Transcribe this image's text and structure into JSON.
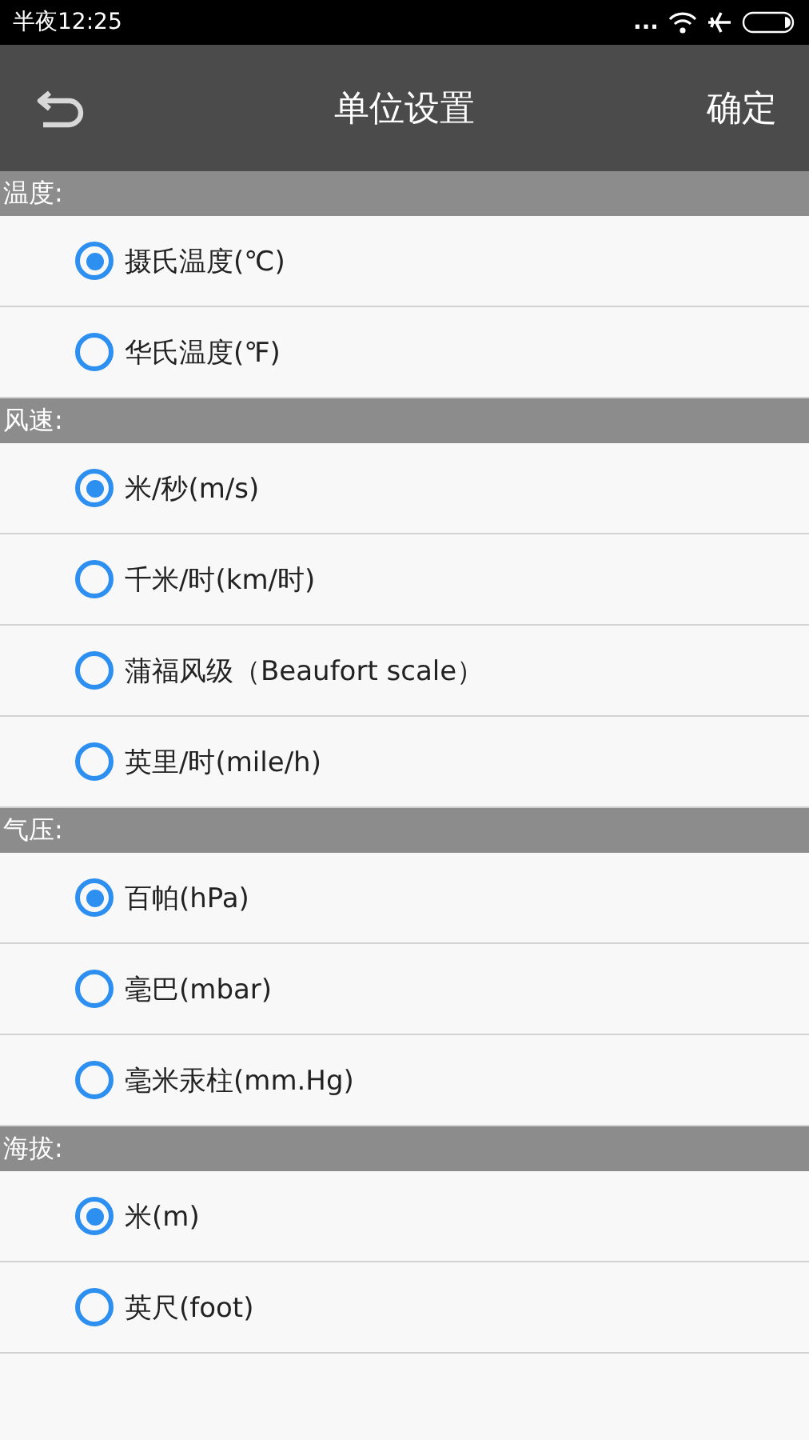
{
  "status_bar": {
    "time": "半夜12:25",
    "dots": "..."
  },
  "header": {
    "title": "单位设置",
    "confirm": "确定"
  },
  "sections": [
    {
      "title": "温度:",
      "options": [
        {
          "label": "摄氏温度(℃)",
          "selected": true
        },
        {
          "label": "华氏温度(℉)",
          "selected": false
        }
      ]
    },
    {
      "title": "风速:",
      "options": [
        {
          "label": "米/秒(m/s)",
          "selected": true
        },
        {
          "label": "千米/时(km/时)",
          "selected": false
        },
        {
          "label": "蒲福风级（Beaufort scale）",
          "selected": false
        },
        {
          "label": "英里/时(mile/h)",
          "selected": false
        }
      ]
    },
    {
      "title": "气压:",
      "options": [
        {
          "label": "百帕(hPa)",
          "selected": true
        },
        {
          "label": "毫巴(mbar)",
          "selected": false
        },
        {
          "label": "毫米汞柱(mm.Hg)",
          "selected": false
        }
      ]
    },
    {
      "title": "海拔:",
      "options": [
        {
          "label": "米(m)",
          "selected": true
        },
        {
          "label": "英尺(foot)",
          "selected": false
        }
      ]
    }
  ]
}
